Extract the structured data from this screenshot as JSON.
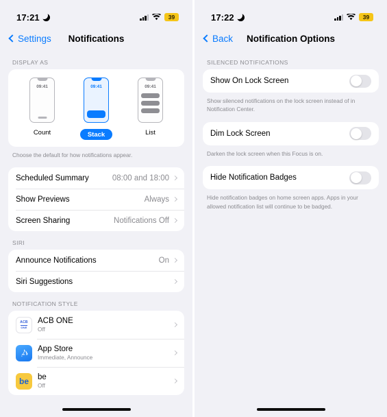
{
  "left": {
    "status": {
      "time": "17:21",
      "battery": "39",
      "moon_icon": "crescent-moon-icon",
      "cellular_icon": "cellular-bars-icon",
      "wifi_icon": "wifi-icon"
    },
    "nav": {
      "back_label": "Settings",
      "title": "Notifications"
    },
    "display_as": {
      "header": "DISPLAY AS",
      "footer": "Choose the default for how notifications appear.",
      "mini_time": "09:41",
      "options": [
        {
          "label": "Count",
          "selected": false
        },
        {
          "label": "Stack",
          "selected": true
        },
        {
          "label": "List",
          "selected": false
        }
      ]
    },
    "general_rows": [
      {
        "label": "Scheduled Summary",
        "value": "08:00 and 18:00"
      },
      {
        "label": "Show Previews",
        "value": "Always"
      },
      {
        "label": "Screen Sharing",
        "value": "Notifications Off"
      }
    ],
    "siri": {
      "header": "SIRI",
      "rows": [
        {
          "label": "Announce Notifications",
          "value": "On"
        },
        {
          "label": "Siri Suggestions",
          "value": ""
        }
      ]
    },
    "notification_style": {
      "header": "NOTIFICATION STYLE",
      "apps": [
        {
          "name": "ACB ONE",
          "sub": "Off",
          "icon": "acb-one-app-icon"
        },
        {
          "name": "App Store",
          "sub": "Immediate, Announce",
          "icon": "app-store-app-icon"
        },
        {
          "name": "be",
          "sub": "Off",
          "icon": "be-app-icon"
        }
      ]
    }
  },
  "right": {
    "status": {
      "time": "17:22",
      "battery": "39",
      "moon_icon": "crescent-moon-icon",
      "cellular_icon": "cellular-bars-icon",
      "wifi_icon": "wifi-icon"
    },
    "nav": {
      "back_label": "Back",
      "title": "Notification Options"
    },
    "silenced": {
      "header": "SILENCED NOTIFICATIONS",
      "groups": [
        {
          "label": "Show On Lock Screen",
          "on": false,
          "footer": "Show silenced notifications on the lock screen instead of in Notification Center."
        },
        {
          "label": "Dim Lock Screen",
          "on": false,
          "footer": "Darken the lock screen when this Focus is on."
        },
        {
          "label": "Hide Notification Badges",
          "on": false,
          "footer": "Hide notification badges on home screen apps. Apps in your allowed notification list will continue to be badged."
        }
      ]
    }
  },
  "colors": {
    "accent": "#0a7cff",
    "background": "#f1f1f6",
    "card": "#ffffff",
    "battery": "#f5c518"
  }
}
